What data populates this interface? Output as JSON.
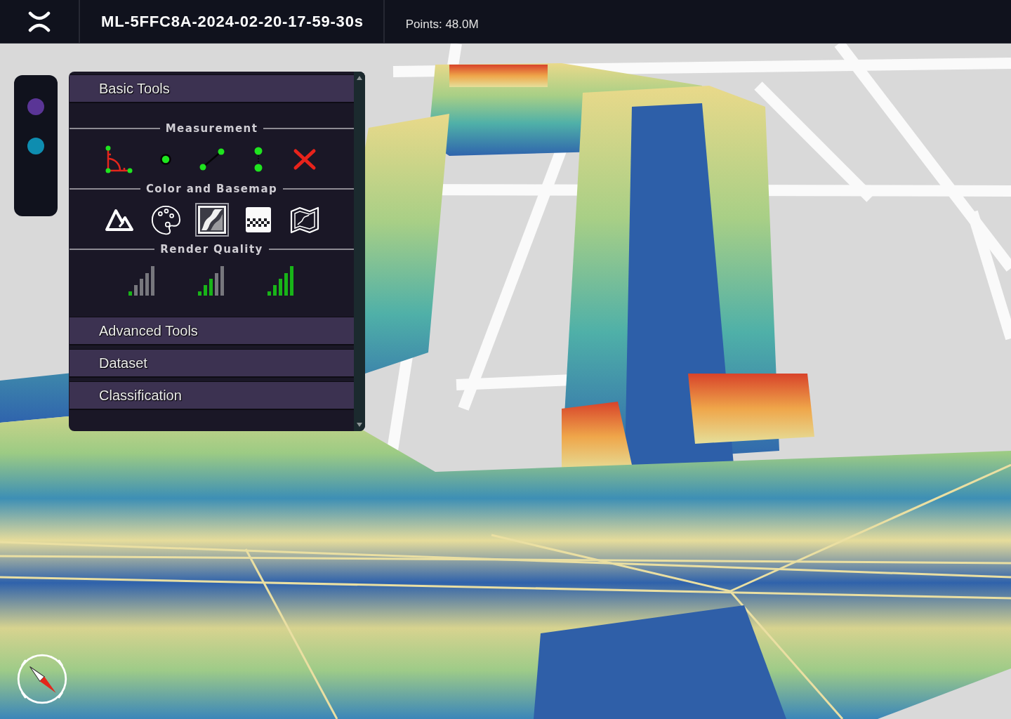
{
  "header": {
    "title": "ML-5FFC8A-2024-02-20-17-59-30s",
    "points": "Points: 48.0M"
  },
  "side_toolbar": {
    "dots": [
      {
        "color": "#5a3596"
      },
      {
        "color": "#0e8db0"
      }
    ]
  },
  "panel": {
    "sections": [
      {
        "title": "Basic Tools",
        "groups": [
          {
            "title": "Measurement",
            "kind": "tools",
            "tools": [
              {
                "kind": "angle",
                "selected": false
              },
              {
                "kind": "point",
                "selected": false
              },
              {
                "kind": "distance",
                "selected": false
              },
              {
                "kind": "height",
                "selected": false
              },
              {
                "kind": "clear",
                "selected": false
              }
            ]
          },
          {
            "title": "Color and Basemap",
            "kind": "tools",
            "tools": [
              {
                "kind": "elevation",
                "selected": false
              },
              {
                "kind": "palette",
                "selected": false
              },
              {
                "kind": "terrain",
                "selected": true
              },
              {
                "kind": "checker",
                "selected": false
              },
              {
                "kind": "map",
                "selected": false
              }
            ]
          },
          {
            "title": "Render Quality",
            "kind": "quality",
            "tools": [
              {
                "kind": "low",
                "selected": false
              },
              {
                "kind": "medium",
                "selected": false
              },
              {
                "kind": "high",
                "selected": false
              }
            ]
          }
        ]
      },
      {
        "title": "Advanced Tools"
      },
      {
        "title": "Dataset"
      },
      {
        "title": "Classification"
      }
    ]
  }
}
